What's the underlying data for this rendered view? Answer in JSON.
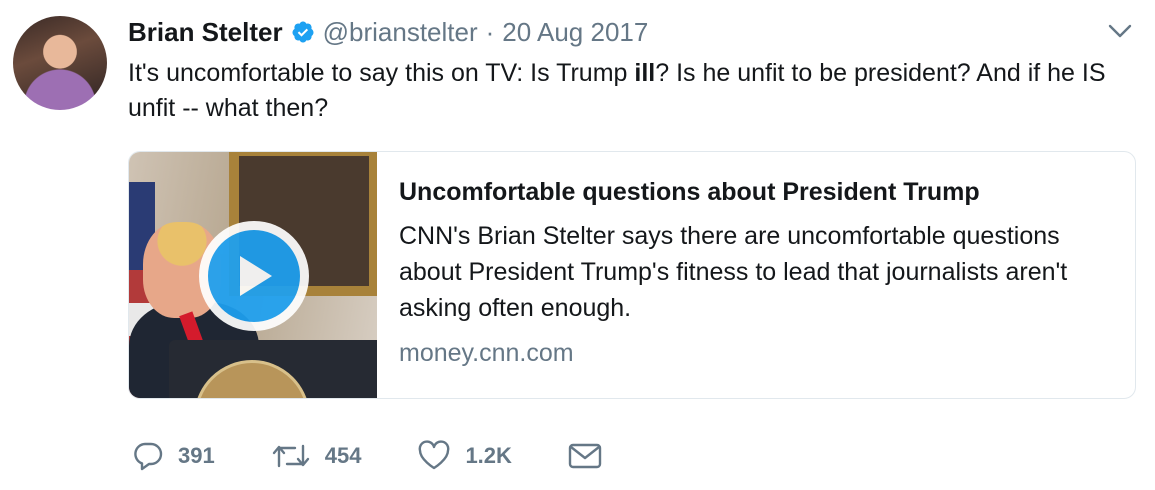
{
  "tweet": {
    "author_name": "Brian Stelter",
    "handle": "@brianstelter",
    "separator": "·",
    "date": "20 Aug 2017",
    "text_before": "It's uncomfortable to say this on TV: Is Trump ",
    "text_bold": "ill",
    "text_after": "? Is he unfit to be president? And if he IS unfit -- what then?"
  },
  "card": {
    "title": "Uncomfortable questions about President Trump",
    "description": "CNN's Brian Stelter says there are uncomfortable questions about President Trump's fitness to lead that journalists aren't asking often enough.",
    "domain": "money.cnn.com"
  },
  "actions": {
    "replies": "391",
    "retweets": "454",
    "likes": "1.2K"
  },
  "colors": {
    "accent": "#1da1f2",
    "muted": "#657786",
    "text": "#14171a"
  },
  "icons": [
    "verified-badge-icon",
    "chevron-down-icon",
    "play-icon",
    "reply-icon",
    "retweet-icon",
    "like-icon",
    "direct-message-icon"
  ]
}
